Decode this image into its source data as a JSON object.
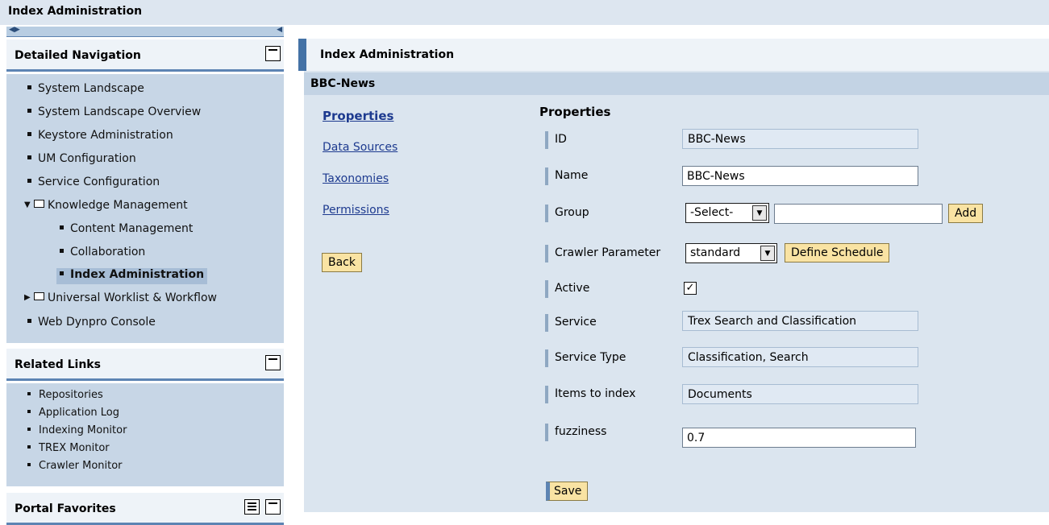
{
  "app_title": "Index Administration",
  "detailed_navigation": {
    "title": "Detailed Navigation",
    "items": [
      {
        "label": "System Landscape"
      },
      {
        "label": "System Landscape Overview"
      },
      {
        "label": "Keystore Administration"
      },
      {
        "label": "UM Configuration"
      },
      {
        "label": "Service Configuration"
      },
      {
        "label": "Knowledge Management"
      },
      {
        "label": "Content Management"
      },
      {
        "label": "Collaboration"
      },
      {
        "label": "Index Administration"
      },
      {
        "label": "Universal Worklist & Workflow"
      },
      {
        "label": "Web Dynpro Console"
      }
    ]
  },
  "related_links": {
    "title": "Related Links",
    "items": [
      "Repositories",
      "Application Log",
      "Indexing Monitor",
      "TREX Monitor",
      "Crawler Monitor"
    ]
  },
  "portal_favorites": {
    "title": "Portal Favorites"
  },
  "main": {
    "header": "Index Administration",
    "index_name": "BBC-News",
    "side_links": [
      "Properties",
      "Data Sources",
      "Taxonomies",
      "Permissions"
    ],
    "back_label": "Back",
    "properties_title": "Properties",
    "fields": {
      "id": {
        "label": "ID",
        "value": "BBC-News"
      },
      "name": {
        "label": "Name",
        "value": "BBC-News"
      },
      "group": {
        "label": "Group",
        "select": "-Select-",
        "text": "",
        "add_label": "Add"
      },
      "crawler": {
        "label": "Crawler Parameter",
        "select": "standard",
        "schedule_label": "Define Schedule"
      },
      "active": {
        "label": "Active",
        "checked": true
      },
      "service": {
        "label": "Service",
        "value": "Trex Search and Classification"
      },
      "service_type": {
        "label": "Service Type",
        "value": "Classification, Search"
      },
      "items_to_index": {
        "label": "Items to index",
        "value": "Documents"
      },
      "fuzziness": {
        "label": "fuzziness",
        "value": "0.7"
      }
    },
    "save_label": "Save"
  },
  "colors": {
    "accent": "#4472a6",
    "button": "#f9e3a3",
    "panel": "#c7d6e6"
  }
}
